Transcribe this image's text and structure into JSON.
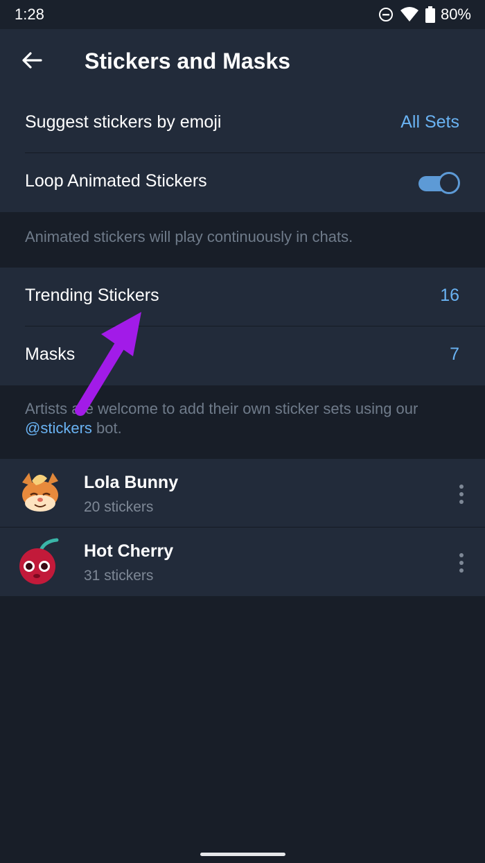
{
  "status_bar": {
    "time": "1:28",
    "battery": "80%",
    "icons": [
      "do-not-disturb-icon",
      "wifi-icon",
      "battery-icon"
    ]
  },
  "app_bar": {
    "title": "Stickers and Masks",
    "back_icon": "arrow-left-icon"
  },
  "settings": {
    "suggest": {
      "label": "Suggest stickers by emoji",
      "value": "All Sets"
    },
    "loop": {
      "label": "Loop Animated Stickers",
      "enabled": true
    },
    "loop_info": "Animated stickers will play continuously in chats.",
    "trending": {
      "label": "Trending Stickers",
      "count": "16"
    },
    "masks": {
      "label": "Masks",
      "count": "7"
    },
    "artists_info_prefix": "Artists are welcome to add their own sticker sets using our ",
    "artists_info_link": "@stickers",
    "artists_info_suffix": " bot."
  },
  "sticker_sets": [
    {
      "title": "Lola Bunny",
      "count": "20 stickers",
      "icon": "lola-bunny-sticker"
    },
    {
      "title": "Hot Cherry",
      "count": "31 stickers",
      "icon": "hot-cherry-sticker"
    }
  ],
  "colors": {
    "accent": "#6ab3f3",
    "background": "#181e28",
    "surface": "#222b3a",
    "annotation_arrow": "#a21be8"
  }
}
